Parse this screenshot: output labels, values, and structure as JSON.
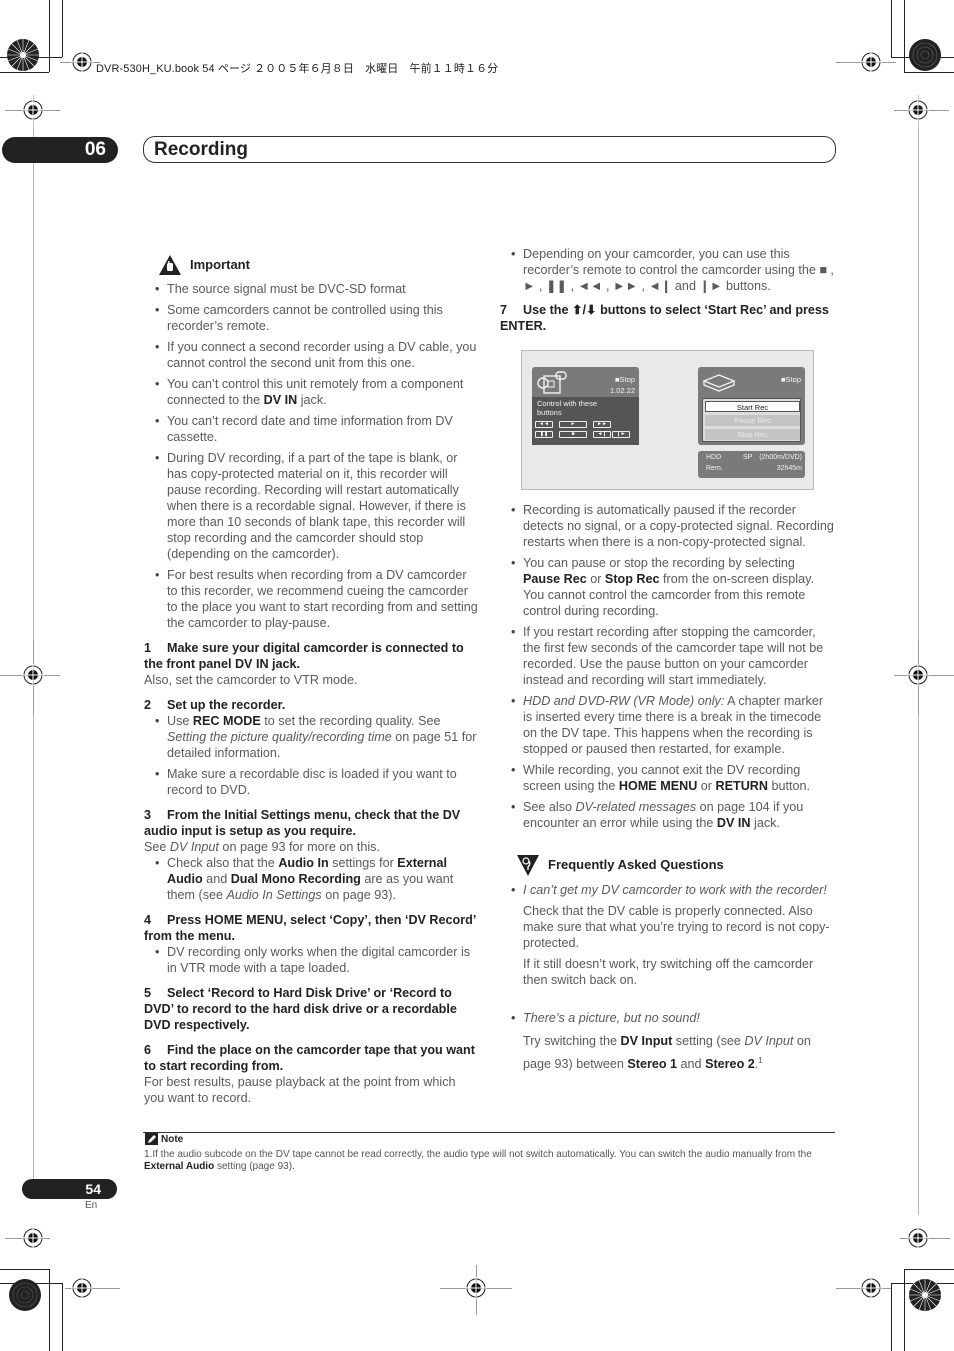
{
  "print_header": "DVR-530H_KU.book  54 ページ  ２００５年６月８日　水曜日　午前１１時１６分",
  "chapter": {
    "number": "06",
    "title": "Recording"
  },
  "important": {
    "icon": "hand-warning-icon",
    "title": "Important",
    "items": [
      [
        {
          "t": "The source signal must be DVC-SD format"
        }
      ],
      [
        {
          "t": "Some camcorders cannot be controlled using this recorder’s remote."
        }
      ],
      [
        {
          "t": "If you connect a second recorder using a DV cable, you cannot control the second unit from this one."
        }
      ],
      [
        {
          "t": "You can’t control this unit remotely from a component connected to the "
        },
        {
          "t": "DV IN",
          "b": true
        },
        {
          "t": " jack."
        }
      ],
      [
        {
          "t": "You can’t record date and time information from DV cassette."
        }
      ],
      [
        {
          "t": "During DV recording, if a part of the tape is blank, or has copy-protected material on it, this recorder will pause recording. Recording will restart automatically when there is a recordable signal. However, if there is more than 10 seconds of blank tape, this recorder will stop recording and the camcorder should stop (depending on the camcorder)."
        }
      ],
      [
        {
          "t": "For best results when recording from a DV camcorder to this recorder, we recommend cueing the camcorder to the place you want to start recording from and setting the camcorder to play-pause."
        }
      ]
    ]
  },
  "steps": [
    {
      "num": "1",
      "head": "Make sure your digital camcorder is connected to the front panel DV IN jack.",
      "text": [
        {
          "t": "Also, set the camcorder to VTR mode."
        }
      ],
      "bullets": []
    },
    {
      "num": "2",
      "head": "Set up the recorder.",
      "text": [],
      "bullets": [
        [
          {
            "t": "Use "
          },
          {
            "t": "REC MODE",
            "b": true
          },
          {
            "t": " to set the recording quality. See "
          },
          {
            "t": "Setting the picture quality/recording time",
            "i": true
          },
          {
            "t": " on page 51 for detailed information."
          }
        ],
        [
          {
            "t": "Make sure a recordable disc is loaded if you want to record to DVD."
          }
        ]
      ]
    },
    {
      "num": "3",
      "head": "From the Initial Settings menu, check that the DV audio input is setup as you require.",
      "text": [
        {
          "t": "See "
        },
        {
          "t": "DV Input",
          "i": true
        },
        {
          "t": " on page 93 for more on this."
        }
      ],
      "bullets": [
        [
          {
            "t": "Check also that the "
          },
          {
            "t": "Audio In",
            "b": true
          },
          {
            "t": " settings for "
          },
          {
            "t": "External Audio",
            "b": true
          },
          {
            "t": " and "
          },
          {
            "t": "Dual Mono Recording",
            "b": true
          },
          {
            "t": " are as you want them (see "
          },
          {
            "t": "Audio In Settings",
            "i": true
          },
          {
            "t": " on page 93)."
          }
        ]
      ]
    },
    {
      "num": "4",
      "head": "Press HOME MENU, select ‘Copy’, then ‘DV Record’ from the menu.",
      "text": [],
      "bullets": [
        [
          {
            "t": "DV recording only works when the digital camcorder is in VTR mode with a tape loaded."
          }
        ]
      ]
    },
    {
      "num": "5",
      "head": "Select ‘Record to Hard Disk Drive’ or ‘Record to DVD’ to record to the hard disk drive or a recordable DVD respectively.",
      "text": [],
      "bullets": []
    },
    {
      "num": "6",
      "head": "Find the place on the camcorder tape that you want to start recording from.",
      "text": [
        {
          "t": "For best results, pause playback at the point from which you want to record."
        }
      ],
      "bullets": []
    }
  ],
  "right_intro_bullet": [
    {
      "t": "Depending on your camcorder, you can use this recorder’s remote to control the camcorder using the ■ , ► , ❚❚ , ◄◄ , ►► , ◄❙ and ❙► buttons."
    }
  ],
  "step7": {
    "num": "7",
    "head": "Use the ⬆/⬇ buttons to select ‘Start Rec’ and press ENTER."
  },
  "osd": {
    "camcorder": {
      "icon": "camcorder-icon",
      "status": "■Stop",
      "timecode": "1.02.22",
      "hint": "Control with these buttons",
      "buttons": [
        "◄◄",
        "►",
        "►►",
        "❚❚",
        "■",
        "◄❙",
        "❙►"
      ]
    },
    "recorder": {
      "icon": "recorder-icon",
      "status": "■Stop",
      "menu": [
        {
          "label": "Start Rec",
          "state": "active"
        },
        {
          "label": "Pause Rec",
          "state": "disabled"
        },
        {
          "label": "Stop Rec",
          "state": "disabled"
        }
      ],
      "info": {
        "drive": "HDD",
        "mode": "SP",
        "mode_detail": "(2h00m/DVD)",
        "rem_label": "Rem.",
        "rem_value": "32h45m"
      }
    }
  },
  "right_bullets": [
    [
      {
        "t": "Recording is automatically paused if the recorder detects no signal, or a copy-protected signal. Recording restarts when there is a non-copy-protected signal."
      }
    ],
    [
      {
        "t": "You can pause or stop the recording by selecting "
      },
      {
        "t": "Pause Rec",
        "b": true
      },
      {
        "t": " or "
      },
      {
        "t": "Stop Rec",
        "b": true
      },
      {
        "t": " from the on-screen display. You cannot control the camcorder from this remote control during recording."
      }
    ],
    [
      {
        "t": "If you restart recording after stopping the camcorder, the first few seconds of the camcorder tape will not be recorded. Use the pause button on your camcorder instead and recording will start immediately."
      }
    ],
    [
      {
        "t": "HDD and DVD-RW (VR Mode) only:",
        "i": true
      },
      {
        "t": " A chapter marker is inserted every time there is a break in the timecode on the DV tape. This happens when the recording is stopped or paused then restarted, for example."
      }
    ],
    [
      {
        "t": "While recording, you cannot exit the DV recording screen using the "
      },
      {
        "t": "HOME MENU",
        "b": true
      },
      {
        "t": " or "
      },
      {
        "t": "RETURN",
        "b": true
      },
      {
        "t": " button."
      }
    ],
    [
      {
        "t": "See also "
      },
      {
        "t": "DV-related messages",
        "i": true
      },
      {
        "t": " on page 104 if you encounter an error while using the "
      },
      {
        "t": "DV IN",
        "b": true
      },
      {
        "t": " jack."
      }
    ]
  ],
  "faq": {
    "icon": "question-icon",
    "title": "Frequently Asked Questions",
    "items": [
      {
        "q": "I can’t get my DV camcorder to work with the recorder!",
        "answers": [
          [
            {
              "t": "Check that the DV cable is properly connected. Also make sure that what you’re trying to record is not copy-protected."
            }
          ],
          [
            {
              "t": "If it still doesn’t work, try switching off the camcorder then switch back on."
            }
          ]
        ]
      },
      {
        "q": "There’s a picture, but no sound!",
        "answers": [
          [
            {
              "t": "Try switching the "
            },
            {
              "t": "DV Input",
              "b": true
            },
            {
              "t": " setting (see "
            },
            {
              "t": "DV Input",
              "i": true
            },
            {
              "t": " on page 93) between "
            },
            {
              "t": "Stereo 1",
              "b": true
            },
            {
              "t": " and "
            },
            {
              "t": "Stereo 2",
              "b": true
            },
            {
              "t": "."
            },
            {
              "t": "1",
              "sup": true
            }
          ]
        ]
      }
    ]
  },
  "note": {
    "icon": "pencil-note-icon",
    "title": "Note",
    "items": [
      [
        {
          "t": "1.If the audio subcode on the DV tape cannot be read correctly, the audio type will not switch automatically. You can switch the audio manually from the "
        },
        {
          "t": "External Audio",
          "b": true
        },
        {
          "t": " setting (page 93)."
        }
      ]
    ]
  },
  "footer": {
    "page_number": "54",
    "language": "En"
  }
}
